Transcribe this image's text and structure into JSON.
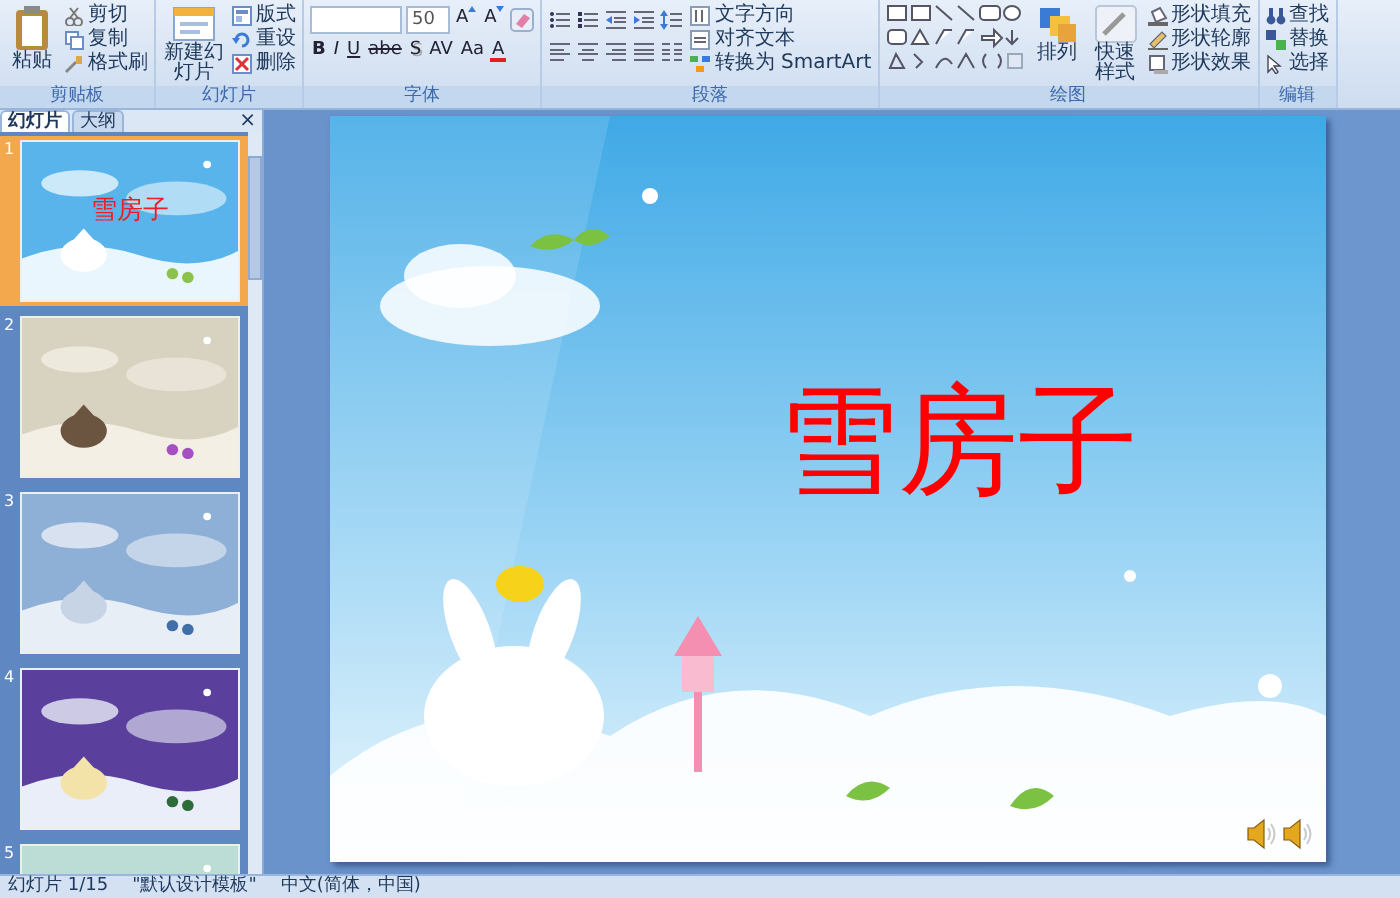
{
  "ribbon": [
    {
      "kind": "clipboard",
      "label": "剪贴板",
      "paste": "粘贴",
      "commands": [
        "剪切",
        "复制",
        "格式刷"
      ]
    },
    {
      "kind": "slides",
      "label": "幻灯片",
      "new_slide": "新建幻灯片",
      "commands": [
        "版式",
        "重设",
        "删除"
      ]
    },
    {
      "kind": "font",
      "label": "字体",
      "font_size": "50",
      "size_buttons": [
        "A",
        "A"
      ],
      "formats": [
        "B",
        "I",
        "U",
        "abe",
        "S",
        "AV",
        "Aa",
        "A"
      ]
    },
    {
      "kind": "paragraph",
      "label": "段落",
      "commands": [
        "文字方向",
        "对齐文本",
        "转换为 SmartArt"
      ]
    },
    {
      "kind": "drawing",
      "label": "绘图",
      "arrange": "排列",
      "quick_styles": "快速样式",
      "commands": [
        "形状填充",
        "形状轮廓",
        "形状效果"
      ]
    },
    {
      "kind": "editing",
      "label": "编辑",
      "commands": [
        "查找",
        "替换",
        "选择"
      ]
    }
  ],
  "panel": {
    "tabs": [
      {
        "label": "幻灯片",
        "selected": true
      },
      {
        "label": "大纲",
        "selected": false
      }
    ],
    "close": "×",
    "slides": [
      {
        "number": "1",
        "selected": true,
        "title": "雪房子"
      },
      {
        "number": "2",
        "selected": false
      },
      {
        "number": "3",
        "selected": false
      },
      {
        "number": "4",
        "selected": false
      },
      {
        "number": "5",
        "selected": false
      }
    ]
  },
  "slide": {
    "title": "雪房子"
  },
  "status_bar": [
    "幻灯片 1/15",
    "\"默认设计模板\"",
    "中文(简体，中国)"
  ]
}
